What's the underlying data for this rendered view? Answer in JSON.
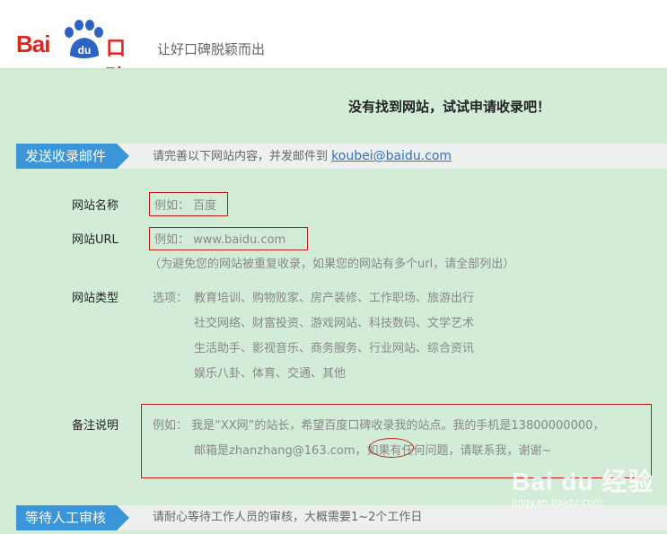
{
  "header": {
    "logo_text": "Bai",
    "logo_paw_text": "du",
    "logo_cn": "口碑",
    "slogan": "让好口碑脱颖而出"
  },
  "page_title": "没有找到网站，试试申请收录吧！",
  "section_email": {
    "tag": "发送收录邮件",
    "desc": "请完善以下网站内容，并发邮件到",
    "email": "koubei@baidu.com"
  },
  "form": {
    "site_name": {
      "label": "网站名称",
      "example": "例如： 百度"
    },
    "site_url": {
      "label": "网站URL",
      "example": "例如： www.baidu.com",
      "note": "（为避免您的网站被重复收录，如果您的网站有多个url，请全部列出）"
    },
    "site_type": {
      "label": "网站类型",
      "prefix": "选项：",
      "lines": [
        "教育培训、购物败家、房产装修、工作职场、旅游出行",
        "社交网络、财富投资、游戏网站、科技数码、文学艺术",
        "生活助手、影视音乐、商务服务、行业网站、综合资讯",
        "娱乐八卦、体育、交通、其他"
      ]
    },
    "remarks": {
      "label": "备注说明",
      "line1": "例如： 我是“XX网”的站长，希望百度口碑收录我的站点。我的手机是13800000000，",
      "line2": "邮箱是zhanzhang@163.com，如果有任何问题，请联系我，谢谢~"
    }
  },
  "section_review": {
    "tag": "等待人工审核",
    "desc": "请耐心等待工作人员的审核，大概需要1~2个工作日"
  },
  "watermark": {
    "main": "Bai du 经验",
    "sub": "jingyan.baidu.com"
  },
  "colors": {
    "brand_red": "#e1251b",
    "tag_blue": "#3a96d8",
    "panel_green": "#d3ecd7",
    "annotation_red": "#c0201a"
  }
}
